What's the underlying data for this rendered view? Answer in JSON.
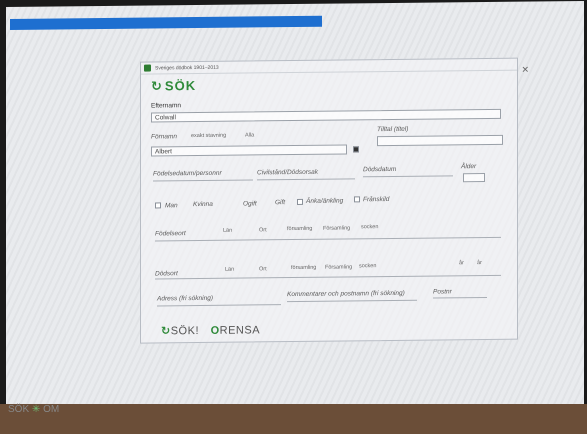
{
  "window": {
    "title": "Sveriges dödbok 1901–2013"
  },
  "logo": {
    "text": "SÖK"
  },
  "fields": {
    "efternamn_label": "Efternamn",
    "efternamn_value": "Colwall",
    "fornamn_label": "Förnamn",
    "fornamn_options": [
      "exakt stavning",
      "Alla"
    ],
    "fornamn_value": "Albert",
    "tilltal_label": "Tilltal (titel)",
    "fodelsedatum_label": "Födelsedatum/personnr",
    "civilstand_label": "Civilstånd/Dödsorsak",
    "dodsdatum_label": "Dödsdatum",
    "alder_label": "Ålder",
    "gender_man": "Man",
    "gender_kvinna": "Kvinna",
    "status_ogift": "Ogift",
    "status_gift": "Gift",
    "status_anka": "Änka/änkling",
    "status_franskild": "Frånskild",
    "fodelseort_label": "Födelseort",
    "fodelseort_options": [
      "Län",
      "Ort",
      "församling",
      "Församling",
      "socken"
    ],
    "dodsort_label": "Dödsort",
    "dodsort_options": [
      "Län",
      "Ort",
      "församling",
      "Församling",
      "socken"
    ],
    "dodsort_right": [
      "år",
      "år"
    ],
    "adress_label": "Adress (fri sökning)",
    "kommentarer_label": "Kommentarer och postnamn (fri sökning)",
    "postnr_label": "Postnr"
  },
  "buttons": {
    "sok": "SÖK!",
    "rensa": "RENSA"
  },
  "bottom": {
    "left": "SÖK",
    "right": "OM"
  },
  "colors": {
    "accent_green": "#2f8a3a",
    "top_bar_blue": "#1e6fd0"
  }
}
